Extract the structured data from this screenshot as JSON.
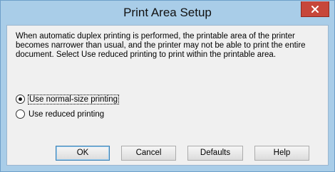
{
  "window": {
    "title": "Print Area Setup",
    "close_label": "✕"
  },
  "message": "When automatic duplex printing is performed, the printable area of the printer becomes narrower than usual, and the printer may not be able to print the entire document. Select Use reduced printing to print within the printable area.",
  "options": [
    {
      "label": "Use normal-size printing",
      "selected": true
    },
    {
      "label": "Use reduced printing",
      "selected": false
    }
  ],
  "buttons": {
    "ok": "OK",
    "cancel": "Cancel",
    "defaults": "Defaults",
    "help": "Help"
  },
  "colors": {
    "frame": "#a9cde8",
    "close": "#c7473a"
  }
}
